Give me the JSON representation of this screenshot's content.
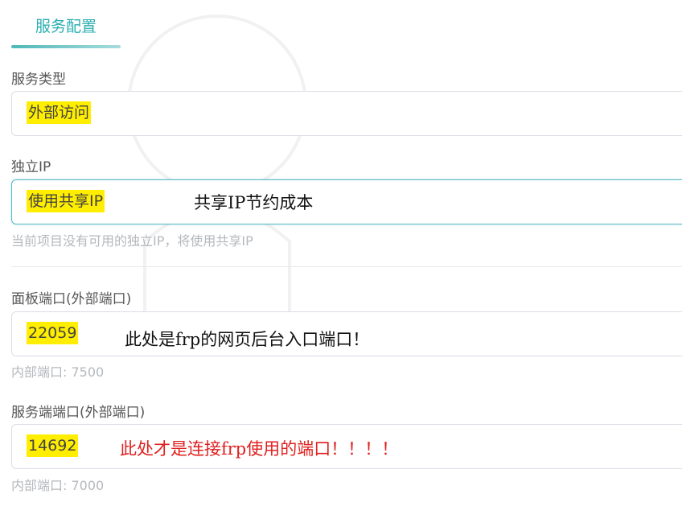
{
  "tab": {
    "label": "服务配置"
  },
  "service_type": {
    "label": "服务类型",
    "value": "外部访问"
  },
  "dedicated_ip": {
    "label": "独立IP",
    "value": "使用共享IP",
    "annotation": "共享IP节约成本",
    "hint": "当前项目没有可用的独立IP，将使用共享IP"
  },
  "panel_port": {
    "label": "面板端口(外部端口)",
    "value": "22059",
    "annotation": "此处是frp的网页后台入口端口！",
    "hint": "内部端口: 7500"
  },
  "service_port": {
    "label": "服务端端口(外部端口)",
    "value": "14692",
    "annotation": "此处才是连接frp使用的端口！！！！",
    "hint": "内部端口: 7000"
  },
  "colors": {
    "accent": "#2aaeb0",
    "highlight": "#ffee00",
    "annotation_red": "#e02020",
    "hint": "#b5b8bd"
  }
}
